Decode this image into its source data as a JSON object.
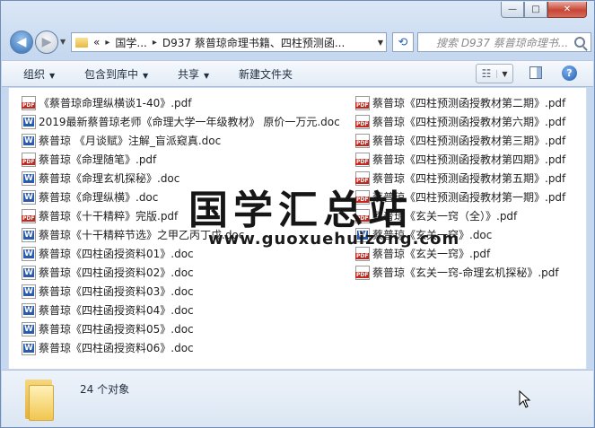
{
  "window": {
    "minimize_glyph": "—",
    "maximize_glyph": "□",
    "close_glyph": "✕"
  },
  "address_bar": {
    "overflow": "«",
    "segments": [
      "国学...",
      "D937 蔡普琼命理书籍、四柱预测函..."
    ],
    "separator": "▸",
    "search_placeholder": "搜索 D937 蔡普琼命理书..."
  },
  "toolbar": {
    "organize": "组织",
    "include_in_library": "包含到库中",
    "share": "共享",
    "new_folder": "新建文件夹"
  },
  "files_left": [
    {
      "type": "pdf",
      "name": "《蔡普琼命理纵横谈1-40》.pdf"
    },
    {
      "type": "doc",
      "name": "2019最新蔡普琼老师《命理大学一年级教材》 原价一万元.doc"
    },
    {
      "type": "doc",
      "name": "蔡普琼 《月谈赋》注解_盲派窥真.doc"
    },
    {
      "type": "pdf",
      "name": "蔡普琼《命理随笔》.pdf"
    },
    {
      "type": "doc",
      "name": "蔡普琼《命理玄机探秘》.doc"
    },
    {
      "type": "doc",
      "name": "蔡普琼《命理纵横》.doc"
    },
    {
      "type": "pdf",
      "name": "蔡普琼《十干精粹》完版.pdf"
    },
    {
      "type": "doc",
      "name": "蔡普琼《十干精粹节选》之甲乙丙丁戊.doc"
    },
    {
      "type": "doc",
      "name": "蔡普琼《四柱函授资料01》.doc"
    },
    {
      "type": "doc",
      "name": "蔡普琼《四柱函授资料02》.doc"
    },
    {
      "type": "doc",
      "name": "蔡普琼《四柱函授资料03》.doc"
    },
    {
      "type": "doc",
      "name": "蔡普琼《四柱函授资料04》.doc"
    },
    {
      "type": "doc",
      "name": "蔡普琼《四柱函授资料05》.doc"
    },
    {
      "type": "doc",
      "name": "蔡普琼《四柱函授资料06》.doc"
    }
  ],
  "files_right": [
    {
      "type": "pdf",
      "name": "蔡普琼《四柱预测函授教材第二期》.pdf"
    },
    {
      "type": "pdf",
      "name": "蔡普琼《四柱预测函授教材第六期》.pdf"
    },
    {
      "type": "pdf",
      "name": "蔡普琼《四柱预测函授教材第三期》.pdf"
    },
    {
      "type": "pdf",
      "name": "蔡普琼《四柱预测函授教材第四期》.pdf"
    },
    {
      "type": "pdf",
      "name": "蔡普琼《四柱预测函授教材第五期》.pdf"
    },
    {
      "type": "pdf",
      "name": "蔡普琼《四柱预测函授教材第一期》.pdf"
    },
    {
      "type": "pdf",
      "name": "蔡普琼《玄关一窍（全）》.pdf"
    },
    {
      "type": "doc",
      "name": "蔡普琼《玄关一窍》.doc"
    },
    {
      "type": "pdf",
      "name": "蔡普琼《玄关一窍》.pdf"
    },
    {
      "type": "pdf",
      "name": "蔡普琼《玄关一窍-命理玄机探秘》.pdf"
    }
  ],
  "watermark": {
    "title": "国学汇总站",
    "url": "www.guoxuehuizong.com"
  },
  "status": {
    "count": "24 个对象"
  }
}
